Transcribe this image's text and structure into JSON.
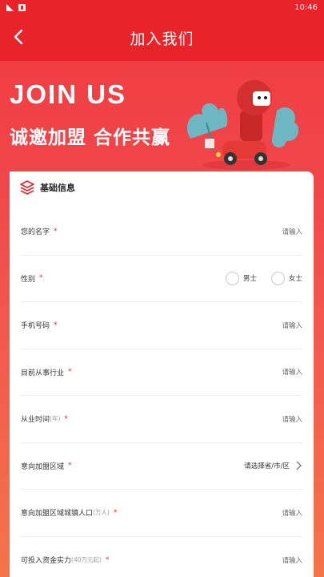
{
  "status_bar": {
    "time": "10:46"
  },
  "app_bar": {
    "title": "加入我们"
  },
  "hero": {
    "title_en": "JOIN US",
    "subtitle_cn": "诚邀加盟 合作共赢"
  },
  "section": {
    "title": "基础信息"
  },
  "form": {
    "fields": [
      {
        "label": "您的名字",
        "value": "请输入"
      },
      {
        "label": "性别",
        "options": [
          "男士",
          "女士"
        ]
      },
      {
        "label": "手机号码",
        "value": "请输入"
      },
      {
        "label": "目前从事行业",
        "value": "请输入"
      },
      {
        "label": "从业时间",
        "hint": "(年)",
        "value": "请输入"
      },
      {
        "label": "意向加盟区域",
        "value": "请选择省/市/区"
      },
      {
        "label": "意向加盟区域城镇人口",
        "hint": "(万人)",
        "value": "请输入"
      },
      {
        "label": "可投入资金实力",
        "hint": "(40万元起)",
        "value": "请输入"
      }
    ],
    "required_mark": "*"
  },
  "colors": {
    "brand_red": "#e8232a",
    "required": "#e8232a"
  }
}
